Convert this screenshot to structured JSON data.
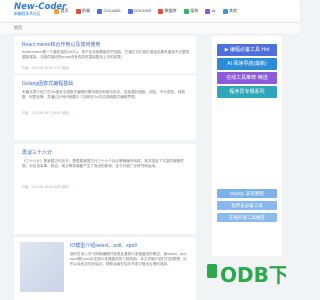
{
  "logo": {
    "mark": "New-Coder",
    "tagline": "新编程技术社区"
  },
  "nav": [
    {
      "label": "首页",
      "color": "#f0a23b"
    },
    {
      "label": "前端",
      "color": "#e0513b"
    },
    {
      "label": "GOLANG",
      "color": "#4f6edc"
    },
    {
      "label": "DOCKER",
      "color": "#4f6edc"
    },
    {
      "label": "数据库",
      "color": "#e0513b"
    },
    {
      "label": "架构",
      "color": "#3bb06a"
    },
    {
      "label": "AI",
      "color": "#8c5ad8"
    },
    {
      "label": "其他",
      "color": "#3b96e0"
    }
  ],
  "breadcrumb": "首页",
  "posts": [
    {
      "title": "React.memo和合作用以及如何使用",
      "excerpt": "React.memo是一个高阶组件(HOC)，用于优化函数组件的性能。它通过记忆组件渲染结果来避免不必要的重新渲染，当组件接收的props没有改变时直接复用上次的结果。",
      "meta": "作者：2023-05-19 09:12:07 阅读：..."
    },
    {
      "title": "Golang函数式编程基础",
      "excerpt": "本篇文章介绍了在Go语言中函数式编程的基本概念和常见用法，包括高阶函数、闭包、不可变性、纯函数、柯里化等，并通过示例代码展示了如何在Go中实践函数式编程思想。",
      "meta": "作者：2023-05-18 17:46:41 阅读：..."
    },
    {
      "title": "再谈三十六计",
      "excerpt": "《三十六计》是我国古代兵书，是根据我国古代三十六个兵法策略编写而成，其中蕴含了丰富的谋略思想，对后世军事、政治、商业等领域都产生了深远的影响，至今仍被广泛研究和运用。",
      "meta": "作者：2023-05-18 13:05:22 阅读：..."
    },
    {
      "title": "IO模型介绍select、poll、epoll",
      "excerpt": "我们在深入学习网络编程时经常会遇到IO多路复用的概念，而select、poll、epoll是Linux中实现IO多路复用的三种机制。本文详细介绍它们的原理、区别以及各自的优缺点，帮助读者在实际开发中做出合理的选择。",
      "meta": "作者：2023-05-18 09:51:38 阅读：..."
    }
  ],
  "side": {
    "buttons": [
      {
        "label": "▶ 编程必备工具 Hot",
        "color": "#4f6edc"
      },
      {
        "label": "AI 阅读导航(最新)",
        "color": "#2e8bd8"
      },
      {
        "label": "在线工具推荐·精选",
        "color": "#8a5ad8"
      },
      {
        "label": "程序员专题系列",
        "color": "#2ea8b8"
      }
    ],
    "links": [
      {
        "label": "MySQL 安装教程",
        "color": "#7db2e8"
      },
      {
        "label": "程序员必备工具",
        "color": "#88b8ee"
      },
      {
        "label": "在线开发工具推荐",
        "color": "#8ab9ec"
      }
    ]
  },
  "watermark": "ODB下载"
}
